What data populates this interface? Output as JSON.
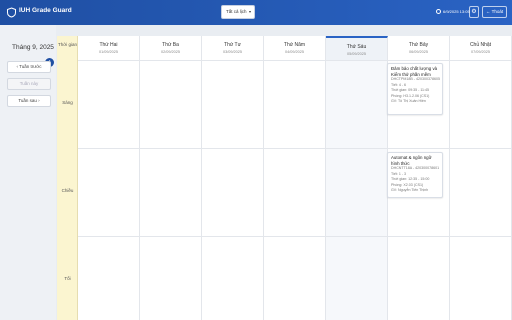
{
  "header": {
    "app_title": "IUH Grade Guard",
    "filter_label": "Tất cả lịch",
    "clock_text": "6/9/2025 13:05",
    "logout_label": "Thoát"
  },
  "sidebar": {
    "month_label": "Tháng 9, 2025",
    "prev_week_label": "Tuần trước",
    "current_week_label": "Tuần này",
    "next_week_label": "Tuần sau"
  },
  "calendar": {
    "time_header": "Thời gian",
    "slots": [
      "Sáng",
      "Chiều",
      "Tối"
    ],
    "days": [
      {
        "name": "Thứ Hai",
        "date": "01/09/2025"
      },
      {
        "name": "Thứ Ba",
        "date": "02/09/2025"
      },
      {
        "name": "Thứ Tư",
        "date": "03/09/2025"
      },
      {
        "name": "Thứ Năm",
        "date": "04/09/2025"
      },
      {
        "name": "Thứ Sáu",
        "date": "05/09/2025"
      },
      {
        "name": "Thứ Bảy",
        "date": "06/09/2025"
      },
      {
        "name": "Chủ Nhật",
        "date": "07/09/2025"
      }
    ],
    "events": [
      {
        "title": "Đảm bảo chất lượng và Kiểm thử phần mềm",
        "code": "DHCTPM18B - 420300378605",
        "periods": "Tiết: 4 - 6",
        "time": "Thời gian: 09:35 - 11:45",
        "room": "Phòng: H3.1.2.06 (CS1)",
        "lecturer": "GV: Tô Thị Xuân Hiền"
      },
      {
        "title": "Automat & ngôn ngữ hình thức",
        "code": "DHCNTT18A - 420300078601",
        "periods": "Tiết: 1 - 3",
        "time": "Thời gian: 12:35 - 15:00",
        "room": "Phòng: X2.03 (CS1)",
        "lecturer": "GV: Nguyễn Tiến Thịnh"
      }
    ]
  },
  "icons": {
    "logo": "shield-icon",
    "collapse": "chevron-left-icon",
    "settings": "gear-icon",
    "logout": "arrow-left-icon"
  },
  "colors": {
    "header_blue": "#2a63c4",
    "time_column": "#fbf5d0"
  }
}
